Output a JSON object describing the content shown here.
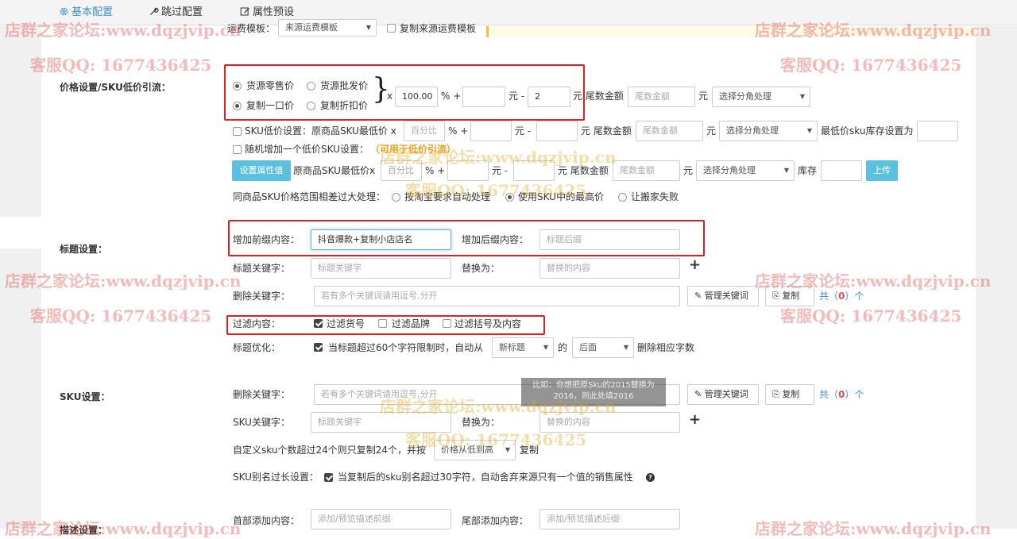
{
  "tabs": [
    {
      "label": "基本配置",
      "icon": "gear-icon"
    },
    {
      "label": "跳过配置",
      "icon": "wrench-icon"
    },
    {
      "label": "属性预设",
      "icon": "edit-icon"
    }
  ],
  "top_partial": {
    "label": "运费模板：",
    "select": "来源运费模板",
    "checkbox": "复制来源运费模板"
  },
  "price": {
    "section": "价格设置/SKU低价引流：",
    "radios": [
      "货源零售价",
      "货源批发价",
      "复制一口价",
      "复制折扣价"
    ],
    "x": "x",
    "multiplier": "100.00",
    "percent_plus": "% +",
    "yuan_minus": "元 -",
    "minus_value": "2",
    "yuan_tail": "元 尾数金额",
    "tail_placeholder": "尾数金额",
    "yuan": "元",
    "rounding_select": "选择分角处理",
    "sku_low_label": "SKU低价设置：原商品SKU最低价 x",
    "percent_placeholder": "百分比",
    "min_stock_label": "最低价sku库存设置为",
    "random_label": "随机增加一个低价SKU设置：",
    "random_note": "（可用于低价引流）",
    "set_attr_button": "设置属性值",
    "orig_min_label": "原商品SKU最低价x",
    "stock_label": "库存",
    "upload_button": "上传",
    "range_label": "同商品SKU价格范围相差过大处理：",
    "range_options": [
      "按淘宝要求自动处理",
      "使用SKU中的最高价",
      "让搬家失败"
    ]
  },
  "title": {
    "section": "标题设置：",
    "prefix_label": "增加前缀内容：",
    "prefix_value": "抖音爆款+复制小店店名",
    "suffix_label": "增加后缀内容：",
    "suffix_placeholder": "标题后缀",
    "keyword_label": "标题关键字：",
    "keyword_placeholder": "标题关键字",
    "replace_label": "替换为：",
    "replace_placeholder": "替换的内容",
    "delete_label": "删除关键字：",
    "delete_placeholder": "若有多个关键词请用逗号,分开",
    "manage_button": "管理关键词",
    "copy_button": "复制",
    "count_prefix": "共（",
    "count": "0",
    "count_suffix": "）个",
    "filter_label": "过滤内容：",
    "filters": [
      "过滤货号",
      "过滤品牌",
      "过滤括号及内容"
    ],
    "optimize_label": "标题优化：",
    "optimize_text": "当标题超过60个字符限制时，自动从",
    "optimize_select1": "新标题",
    "optimize_de": "的",
    "optimize_select2": "后面",
    "optimize_tail": "删除相应字数"
  },
  "sku": {
    "section": "SKU设置：",
    "delete_label": "删除关键字：",
    "delete_placeholder": "若有多个关键词请用逗号,分开",
    "manage_button": "管理关键词",
    "copy_button": "复制",
    "count_prefix": "共（",
    "count": "0",
    "count_suffix": "）个",
    "keyword_label": "SKU关键字：",
    "keyword_placeholder": "标题关键字",
    "replace_label": "替换为：",
    "replace_placeholder": "替换的内容",
    "custom_text": "自定义sku个数超过24个则只复制24个，并按",
    "custom_select": "价格从低到高",
    "custom_tail": "复制",
    "alias_label": "SKU别名过长设置：",
    "alias_text": "当复制后的sku别名超过30字符，自动舍弃来源只有一个值的销售属性",
    "tooltip": "比如：你想把原Sku的2015替换为2016，则此处填2016"
  },
  "desc": {
    "section": "描述设置：",
    "head_label": "首部添加内容：",
    "head_placeholder": "添加/预览描述前缀",
    "tail_label": "尾部添加内容：",
    "tail_placeholder": "添加/预览描述后缀"
  },
  "watermarks": {
    "forum": "店群之家论坛:www.dqzjvip.cn",
    "qq": "客服QQ: 1677436425"
  },
  "colors": {
    "accent": "#3a8fd0",
    "button_blue": "#5bc0de",
    "highlight_red": "#e02020",
    "note_orange": "#f0a020"
  }
}
